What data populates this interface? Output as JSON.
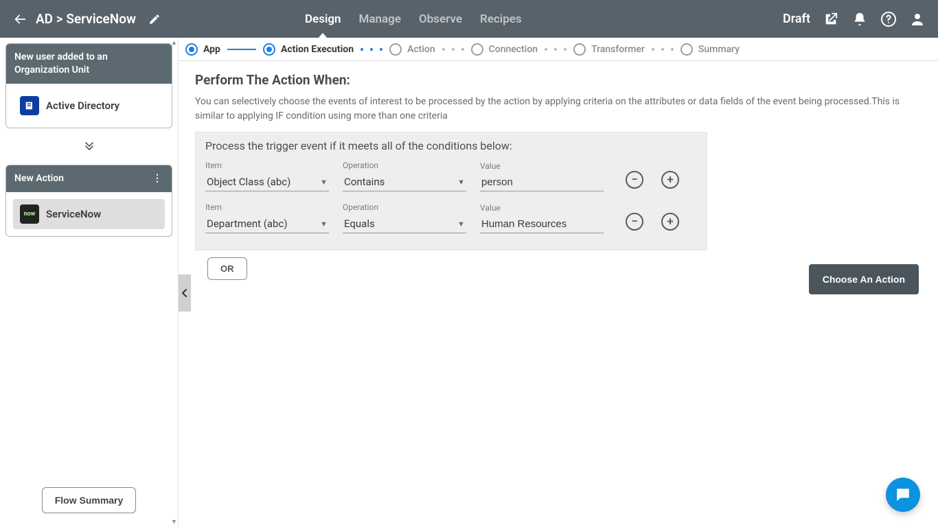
{
  "header": {
    "breadcrumb": "AD > ServiceNow",
    "tabs": [
      "Design",
      "Manage",
      "Observe",
      "Recipes"
    ],
    "active_tab_index": 0,
    "status": "Draft"
  },
  "sidebar": {
    "trigger_card": {
      "title": "New user added to an Organization Unit",
      "app_label": "Active Directory"
    },
    "action_card": {
      "title": "New Action",
      "app_label": "ServiceNow"
    },
    "footer_button": "Flow Summary"
  },
  "stepper": {
    "steps": [
      {
        "label": "App",
        "state": "on"
      },
      {
        "label": "Action Execution",
        "state": "on"
      },
      {
        "label": "Action",
        "state": "off"
      },
      {
        "label": "Connection",
        "state": "off"
      },
      {
        "label": "Transformer",
        "state": "off"
      },
      {
        "label": "Summary",
        "state": "off"
      }
    ]
  },
  "main": {
    "section_title": "Perform The Action When:",
    "section_desc": "You can selectively choose the events of interest to be processed by the action by applying criteria on the attributes or data fields of the event being processed.This is similar to applying IF condition using more than one criteria",
    "condition_header": "Process the trigger event if it meets all of the conditions below:",
    "labels": {
      "item": "Item",
      "operation": "Operation",
      "value": "Value"
    },
    "conditions": [
      {
        "item": "Object Class (abc)",
        "operation": "Contains",
        "value": "person"
      },
      {
        "item": "Department (abc)",
        "operation": "Equals",
        "value": "Human Resources"
      }
    ],
    "or_label": "OR",
    "choose_action_label": "Choose An Action"
  }
}
